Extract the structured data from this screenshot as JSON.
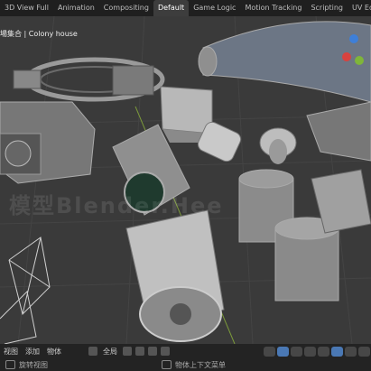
{
  "workspace_tabs": [
    "3D View Full",
    "Animation",
    "Compositing",
    "Default",
    "Game Logic",
    "Motion Tracking",
    "Scripting",
    "UV Editing",
    "V"
  ],
  "active_tab": "Default",
  "viewport": {
    "title": "場集合 | Colony house",
    "watermark": "模型Blender.Hee"
  },
  "header_menu": {
    "view": "视图",
    "add": "添加",
    "object": "物体",
    "transform_orientation": "全局"
  },
  "statusbar": {
    "left_hint": "旋转视图",
    "right_hint": "物体上下文菜单"
  },
  "colors": {
    "gizmo_x": "#d8423e",
    "gizmo_y": "#7fb53a",
    "gizmo_z": "#3e7fd8",
    "active_tab_bg": "#3d3d3d",
    "viewport_bg": "#3a3a3a"
  }
}
